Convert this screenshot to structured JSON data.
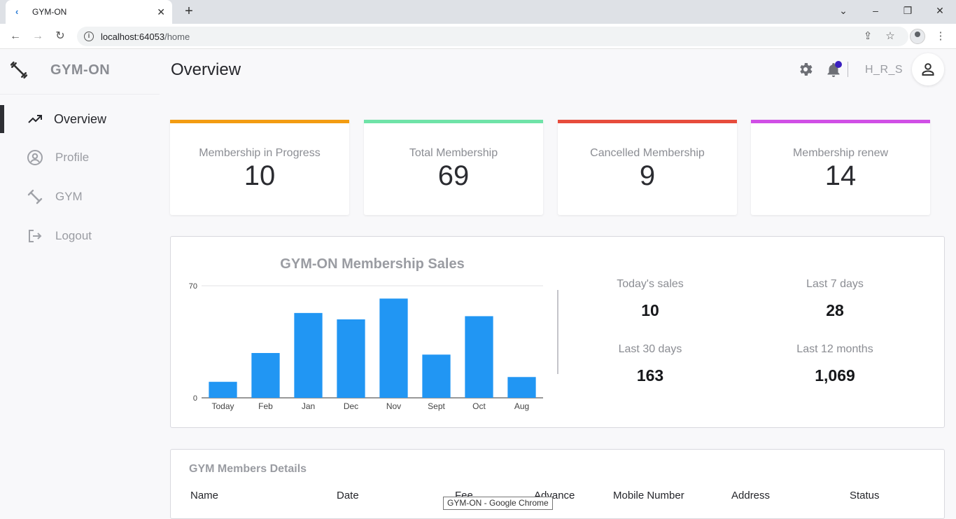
{
  "browser": {
    "tab_title": "GYM-ON",
    "url_host": "localhost:64053",
    "url_path": "/home",
    "tooltip": "GYM-ON - Google Chrome"
  },
  "app": {
    "brand": "GYM-ON",
    "page_title": "Overview",
    "username": "H_R_S",
    "notification_color": "#3a1fbf"
  },
  "sidebar": {
    "items": [
      {
        "label": "Overview",
        "icon": "trending-up-icon",
        "active": true
      },
      {
        "label": "Profile",
        "icon": "account-circle-icon",
        "active": false
      },
      {
        "label": "GYM",
        "icon": "dumbbell-icon",
        "active": false
      },
      {
        "label": "Logout",
        "icon": "logout-icon",
        "active": false
      }
    ]
  },
  "stats": [
    {
      "label": "Membership in Progress",
      "value": "10",
      "color": "#f39c12"
    },
    {
      "label": "Total Membership",
      "value": "69",
      "color": "#6fe3a8"
    },
    {
      "label": "Cancelled Membership",
      "value": "9",
      "color": "#e74c3c"
    },
    {
      "label": "Membership renew",
      "value": "14",
      "color": "#d04fe6"
    }
  ],
  "sales": {
    "today_label": "Today's sales",
    "today_value": "10",
    "week_label": "Last 7 days",
    "week_value": "28",
    "month_label": "Last 30 days",
    "month_value": "163",
    "year_label": "Last 12 months",
    "year_value": "1,069"
  },
  "chart_data": {
    "type": "bar",
    "title": "GYM-ON Membership Sales",
    "categories": [
      "Today",
      "Feb",
      "Jan",
      "Dec",
      "Nov",
      "Sept",
      "Oct",
      "Aug"
    ],
    "values": [
      10,
      28,
      53,
      49,
      62,
      27,
      51,
      13
    ],
    "ylim": [
      0,
      70
    ],
    "yticks": [
      "0",
      "70"
    ],
    "bar_color": "#2196f3",
    "grid": true
  },
  "members": {
    "title": "GYM Members Details",
    "columns": [
      "Name",
      "Date",
      "Fee",
      "Advance",
      "Mobile Number",
      "Address",
      "Status"
    ]
  }
}
